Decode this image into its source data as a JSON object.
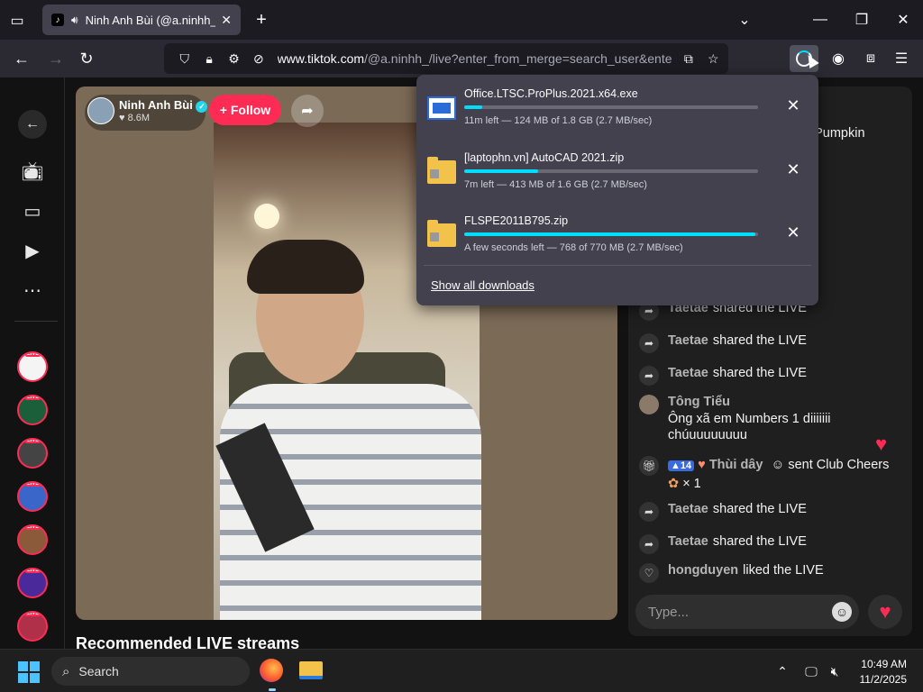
{
  "browser": {
    "tab_title": "Ninh Anh Bùi (@a.ninhh_) is LIVE",
    "url_host": "www.tiktok.com",
    "url_path": "/@a.ninhh_/live?enter_from_merge=search_user&enter_m"
  },
  "stream": {
    "host_name": "Ninh Anh Bùi",
    "host_likes": "♥ 8.6M",
    "follow_label": "+ Follow"
  },
  "recommended_title": "Recommended LIVE streams",
  "chat": {
    "partial_text": "nt Pumpkin",
    "messages": [
      {
        "user": "Taetae",
        "text": "shared the LIVE",
        "icon": "share-icon"
      },
      {
        "user": "Taetae",
        "text": "shared the LIVE",
        "icon": "share-icon"
      },
      {
        "user": "Taetae",
        "text": "shared the LIVE",
        "icon": "share-icon"
      },
      {
        "user": "Tông Tiểu",
        "text": "Ông xã em Numbers 1 diiiiiii chúuuuuuuuu",
        "icon": "avatar"
      },
      {
        "user": "Thùi dây",
        "badge": "14",
        "text": "sent Club Cheers",
        "count": "× 1",
        "icon": "gift-icon"
      },
      {
        "user": "Taetae",
        "text": "shared the LIVE",
        "icon": "share-icon"
      },
      {
        "user": "Taetae",
        "text": "shared the LIVE",
        "icon": "share-icon"
      },
      {
        "user": "hongduyen",
        "text": "liked the LIVE",
        "icon": "heart-outline-icon"
      }
    ],
    "input_placeholder": "Type..."
  },
  "downloads": {
    "items": [
      {
        "name": "Office.LTSC.ProPlus.2021.x64.exe",
        "status": "11m left — 124 MB of 1.8 GB (2.7 MB/sec)",
        "progress": 0.06,
        "icon": "exe-file-icon"
      },
      {
        "name": "[laptophn.vn] AutoCAD 2021.zip",
        "status": "7m left — 413 MB of 1.6 GB (2.7 MB/sec)",
        "progress": 0.25,
        "icon": "zip-folder-icon"
      },
      {
        "name": "FLSPE2011B795.zip",
        "status": "A few seconds left — 768 of 770 MB (2.7 MB/sec)",
        "progress": 0.99,
        "icon": "zip-folder-icon"
      }
    ],
    "show_all_label": "Show all downloads"
  },
  "taskbar": {
    "search_label": "Search",
    "time": "10:49 AM",
    "date": "11/2/2025"
  },
  "colors": {
    "accent_pink": "#fe2c55",
    "progress_cyan": "#00ddff"
  }
}
